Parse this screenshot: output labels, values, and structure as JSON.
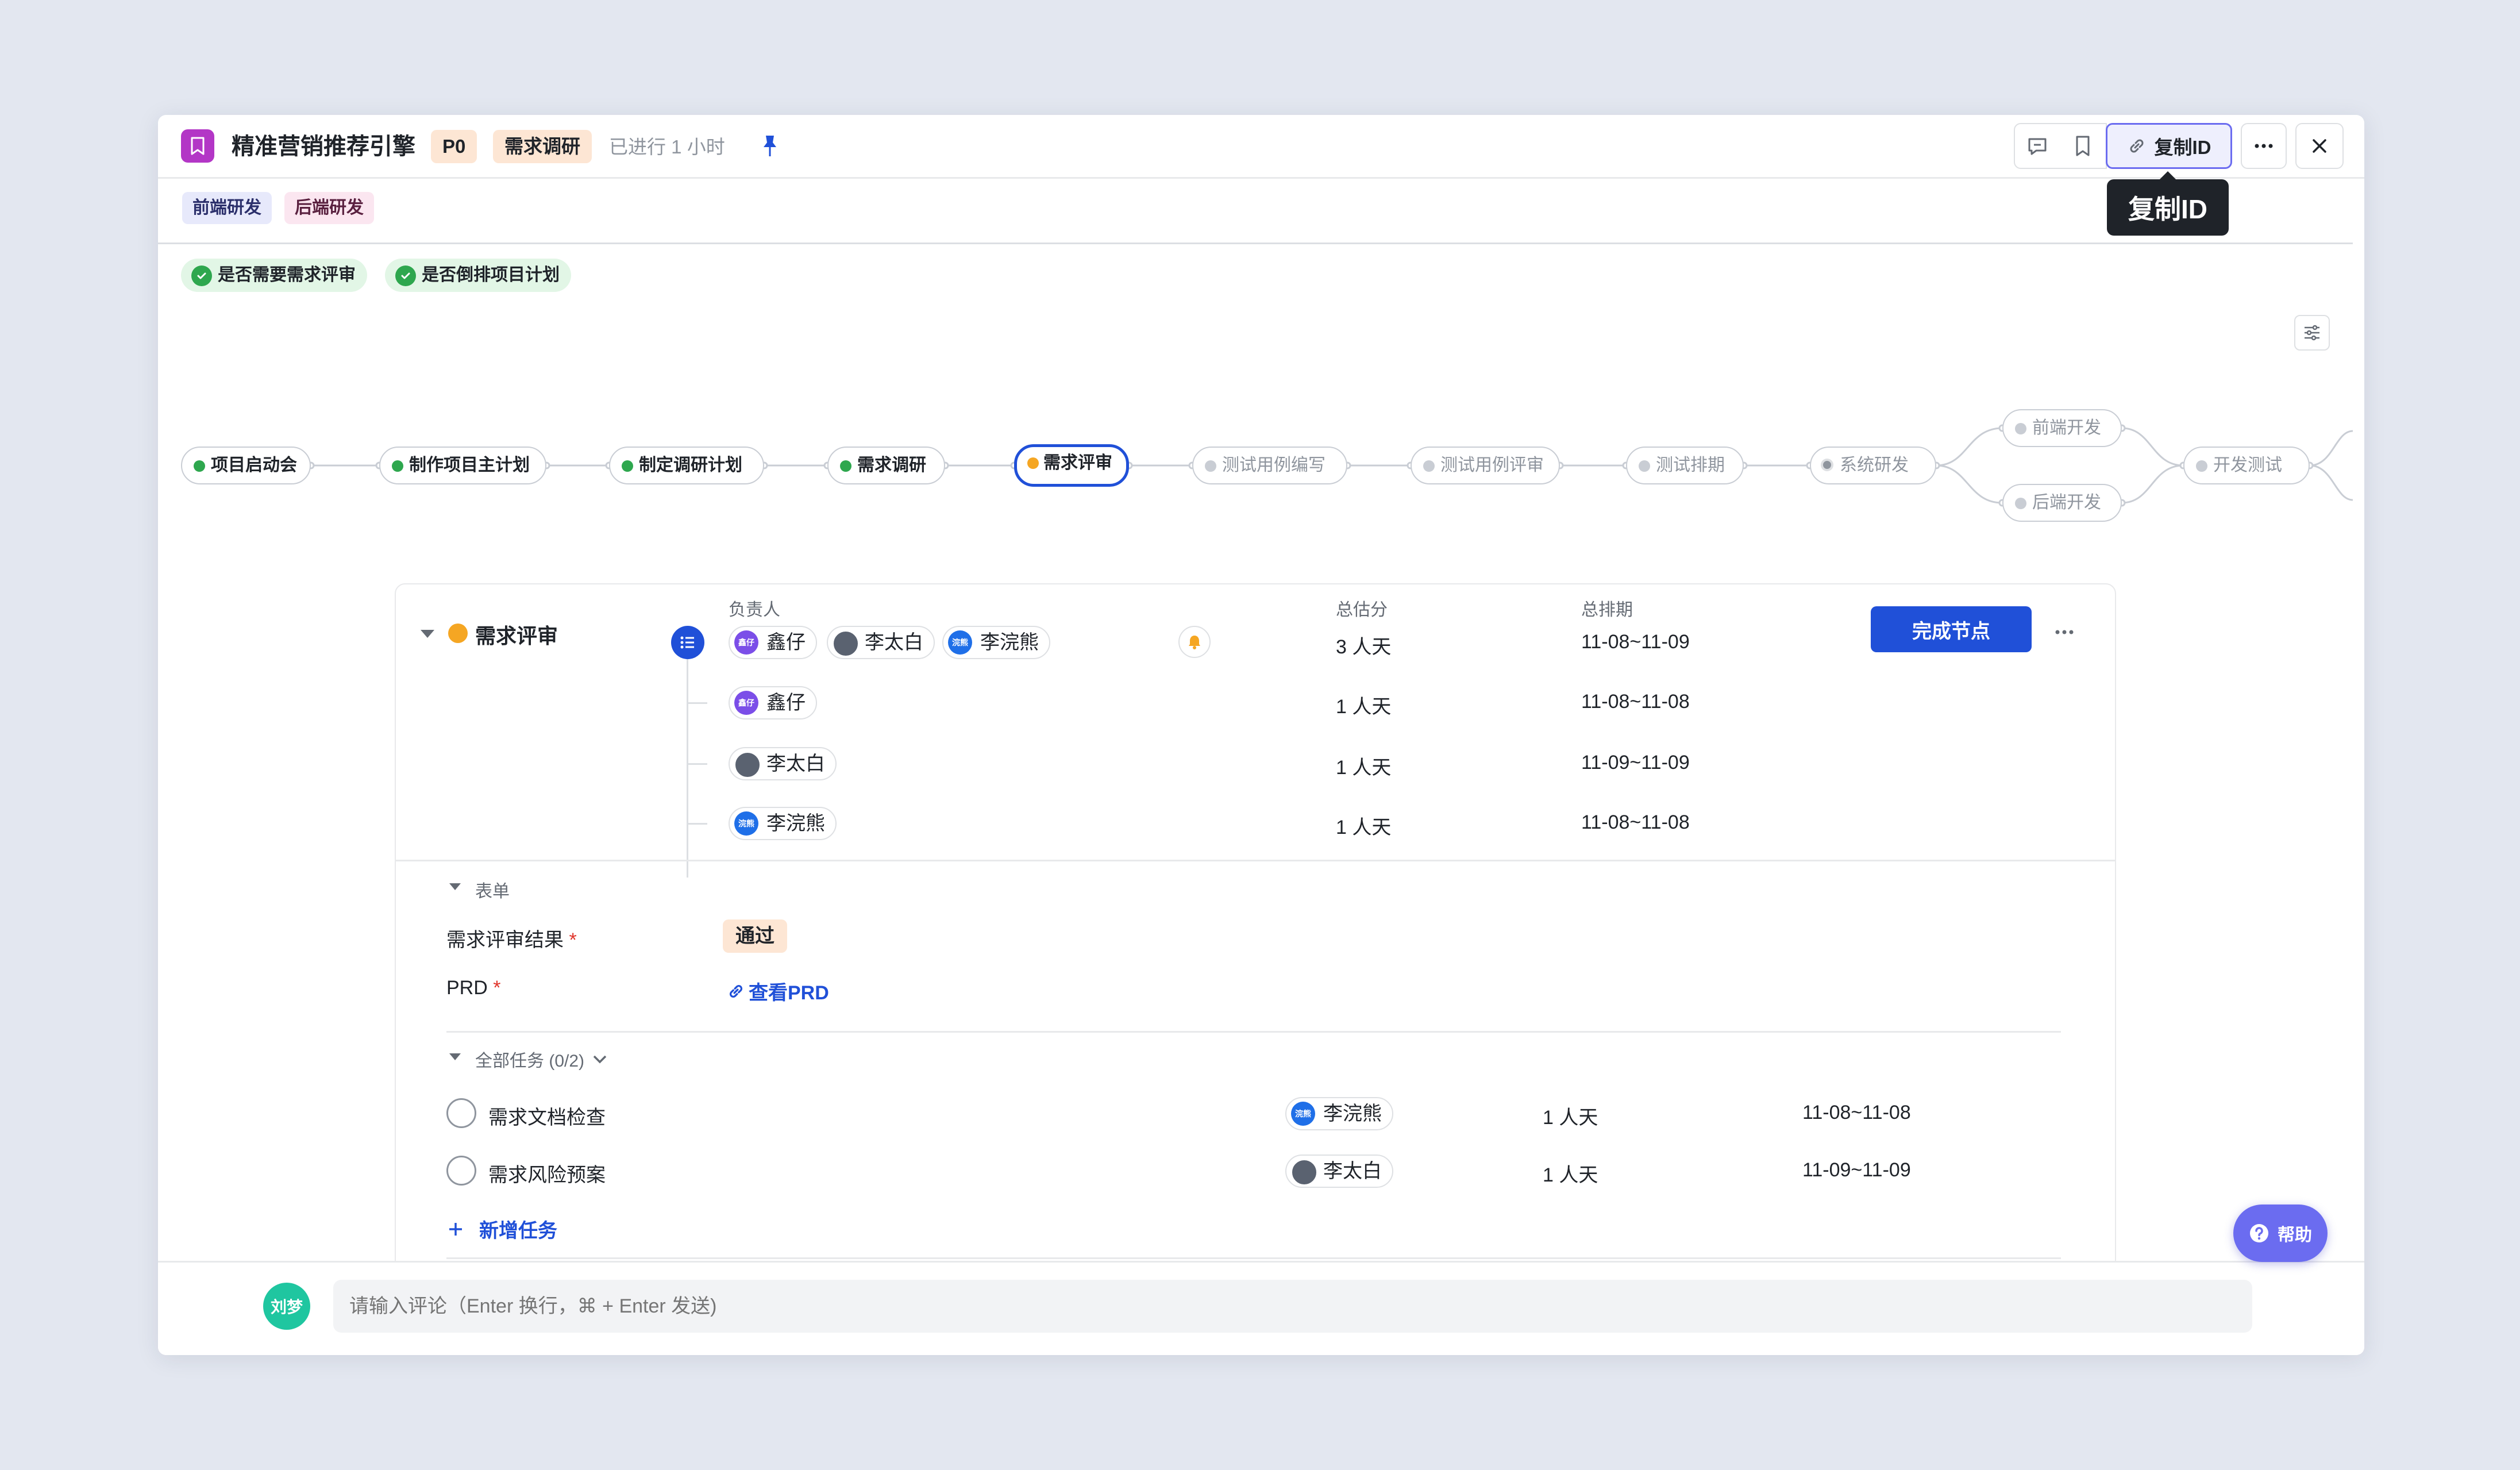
{
  "header": {
    "title": "精准营销推荐引擎",
    "priority": "P0",
    "phase": "需求调研",
    "elapsed": "已进行 1 小时",
    "copy_id_label": "复制ID",
    "tooltip": "复制ID"
  },
  "labels": [
    "前端研发",
    "后端研发"
  ],
  "checks": [
    "是否需要需求评审",
    "是否倒排项目计划"
  ],
  "flow": {
    "nodes": [
      "项目启动会",
      "制作项目主计划",
      "制定调研计划",
      "需求调研",
      "需求评审",
      "测试用例编写",
      "测试用例评审",
      "测试排期",
      "系统研发",
      "前端开发",
      "后端开发",
      "开发测试"
    ],
    "current": "需求评审"
  },
  "detail": {
    "stage_name": "需求评审",
    "col_owner": "负责人",
    "col_estimate": "总估分",
    "col_schedule": "总排期",
    "complete_button": "完成节点",
    "owners": [
      {
        "name": "鑫仔",
        "avatar_text": "鑫仔"
      },
      {
        "name": "李太白",
        "avatar_text": ""
      },
      {
        "name": "李浣熊",
        "avatar_text": "浣熊"
      }
    ],
    "total_estimate": "3 人天",
    "total_schedule": "11-08~11-09",
    "rows": [
      {
        "name": "鑫仔",
        "avatar_text": "鑫仔",
        "estimate": "1 人天",
        "schedule": "11-08~11-08"
      },
      {
        "name": "李太白",
        "avatar_text": "",
        "estimate": "1 人天",
        "schedule": "11-09~11-09"
      },
      {
        "name": "李浣熊",
        "avatar_text": "浣熊",
        "estimate": "1 人天",
        "schedule": "11-08~11-08"
      }
    ]
  },
  "form": {
    "section_title": "表单",
    "result_label": "需求评审结果",
    "result_value": "通过",
    "prd_label": "PRD",
    "prd_link": "查看PRD",
    "required_mark": "*"
  },
  "tasks": {
    "section_title": "全部任务 (0/2)",
    "items": [
      {
        "name": "需求文档检查",
        "owner": "李浣熊",
        "avatar_text": "浣熊",
        "estimate": "1 人天",
        "schedule": "11-08~11-08"
      },
      {
        "name": "需求风险预案",
        "owner": "李太白",
        "avatar_text": "",
        "estimate": "1 人天",
        "schedule": "11-09~11-09"
      }
    ],
    "add_label": "新增任务"
  },
  "help": {
    "label": "帮助"
  },
  "comment": {
    "avatar_text": "刘梦",
    "placeholder": "请输入评论（Enter 换行，⌘ + Enter 发送)"
  }
}
